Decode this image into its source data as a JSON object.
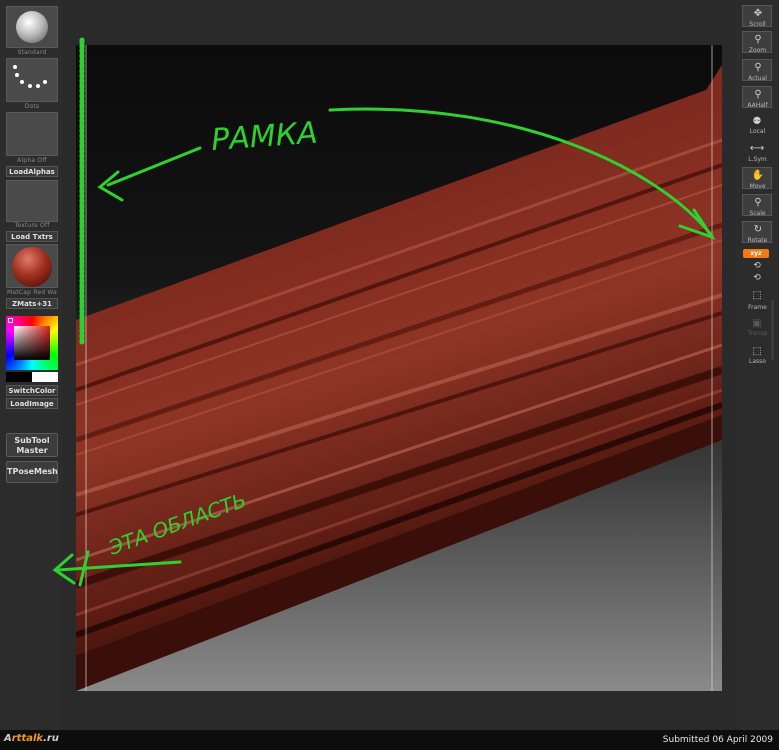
{
  "left_shelf": {
    "brush_label": "Standard",
    "stroke_label": "Dots",
    "alpha_label": "Alpha Off",
    "load_alphas": "LoadAlphas",
    "texture_label": "Texture Off",
    "load_txtrs": "Load Txtrs",
    "material_label": "MatCap Red Wa",
    "zmats": "ZMats+31",
    "switch_color": "SwitchColor",
    "load_image": "LoadImage",
    "subtool_master": "SubTool Master",
    "tposemesh": "TPoseMesh"
  },
  "right_shelf": {
    "buttons": [
      "Scroll",
      "Zoom",
      "Actual",
      "AAHalf",
      "Local",
      "L.Sym",
      "Move",
      "Scale",
      "Rotate",
      "xyz",
      "Frame",
      "Transp",
      "Lasso"
    ]
  },
  "annotations": {
    "frame_word": "РАМКА",
    "area_words": "ЭТА ОБЛАСТЬ"
  },
  "colors": {
    "annotation": "#2fd12f",
    "mesh": "#7a2418",
    "accent": "#f07a18"
  },
  "footer": {
    "logo_prefix": "A",
    "logo_mid": "rttalk",
    "logo_suffix": ".ru",
    "submitted": "Submitted 06 April 2009"
  }
}
